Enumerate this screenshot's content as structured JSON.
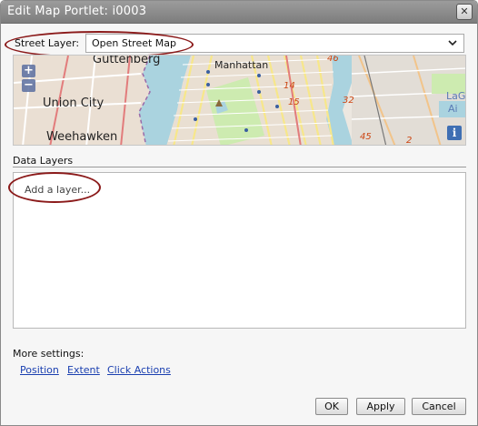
{
  "dialog": {
    "title": "Edit Map Portlet: i0003",
    "close_icon": "close-icon"
  },
  "street_layer": {
    "label": "Street Layer:",
    "value": "Open Street Map",
    "icon": "chevron-down-icon"
  },
  "map": {
    "zoom_in": "+",
    "zoom_out": "−",
    "info": "i",
    "labels": {
      "guttenberg": "Guttenberg",
      "manhattan": "Manhattan",
      "union_city": "Union City",
      "weehawken": "Weehawken",
      "n46": "46",
      "n14": "14",
      "n15": "15",
      "n45": "45",
      "n32": "32",
      "laG": "LaG",
      "ai": "Ai",
      "n2": "2"
    }
  },
  "data_layers": {
    "title": "Data Layers",
    "placeholder": "Add a layer..."
  },
  "more_settings": {
    "label": "More settings:",
    "links": [
      "Position",
      "Extent",
      "Click Actions"
    ]
  },
  "buttons": {
    "ok": "OK",
    "apply": "Apply",
    "cancel": "Cancel"
  },
  "colors": {
    "annotation_ring": "#8b1a1a",
    "link": "#1a3fb0",
    "titlebar": "#8a8a8a"
  }
}
